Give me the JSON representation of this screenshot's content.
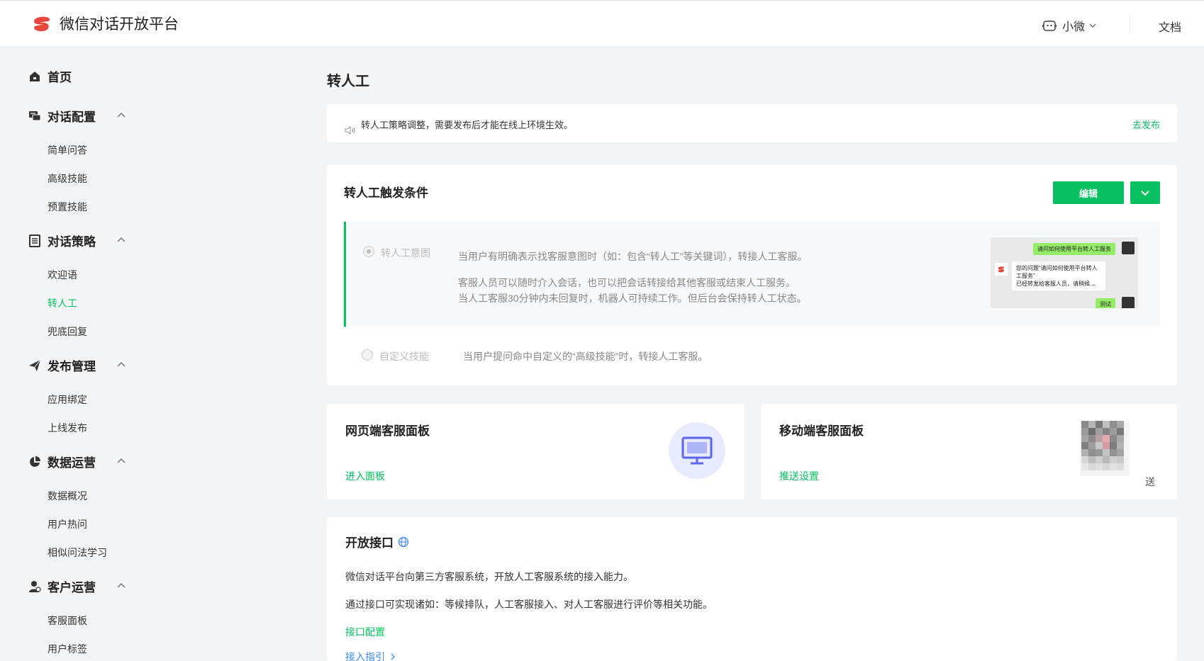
{
  "header": {
    "logo_text": "微信对话开放平台",
    "user_name": "小微",
    "docs_label": "文档"
  },
  "sidebar": {
    "groups": [
      {
        "label": "首页",
        "icon": "home-icon",
        "items": []
      },
      {
        "label": "对话配置",
        "icon": "chat-config-icon",
        "items": [
          "简单问答",
          "高级技能",
          "预置技能"
        ]
      },
      {
        "label": "对话策略",
        "icon": "strategy-icon",
        "items": [
          "欢迎语",
          "转人工",
          "兜底回复"
        ]
      },
      {
        "label": "发布管理",
        "icon": "send-icon",
        "items": [
          "应用绑定",
          "上线发布"
        ]
      },
      {
        "label": "数据运营",
        "icon": "pie-chart-icon",
        "items": [
          "数据概况",
          "用户热问",
          "相似问法学习"
        ]
      },
      {
        "label": "客户运营",
        "icon": "user-icon",
        "items": [
          "客服面板",
          "用户标签"
        ]
      }
    ],
    "active_item": "转人工"
  },
  "main": {
    "page_title": "转人工",
    "notice": {
      "text": "转人工策略调整，需要发布后才能在线上环境生效。",
      "link": "去发布"
    },
    "trigger": {
      "title": "转人工触发条件",
      "edit_label": "编辑",
      "option1": {
        "label": "转人工意图",
        "desc1": "当用户有明确表示找客服意图时（如：包含“转人工”等关键词），转接人工客服。",
        "desc2": "客服人员可以随时介入会话，也可以把会话转接给其他客服或结束人工服务。",
        "desc3": "当人工客服30分钟内未回复时，机器人可持续工作。但后台会保持转人工状态。"
      },
      "preview": {
        "user_msg": "请问如何使用平台转人工服务",
        "bot_line1": "您的问题“请问如何使用平台转人",
        "bot_line2": "工服务”",
        "bot_line3": "已经转发给客服人员，请稍候....",
        "test_msg": "测试"
      },
      "option2": {
        "label": "自定义技能",
        "desc": "当用户提问命中自定义的“高级技能”时，转接人工客服。"
      }
    },
    "web_panel": {
      "title": "网页端客服面板",
      "link": "进入面板"
    },
    "mobile_panel": {
      "title": "移动端客服面板",
      "link": "推送设置",
      "tail": "送"
    },
    "open_api": {
      "title": "开放接口",
      "para1": "微信对话平台向第三方客服系统，开放人工客服系统的接入能力。",
      "para2": "通过接口可实现诸如：等候排队，人工客服接入、对人工客服进行评价等相关功能。",
      "link1": "接口配置",
      "link2": "接入指引"
    }
  },
  "colors": {
    "brand_green": "#07c160",
    "logo_red": "#e8453c",
    "monitor_purple": "#5b67e8"
  }
}
